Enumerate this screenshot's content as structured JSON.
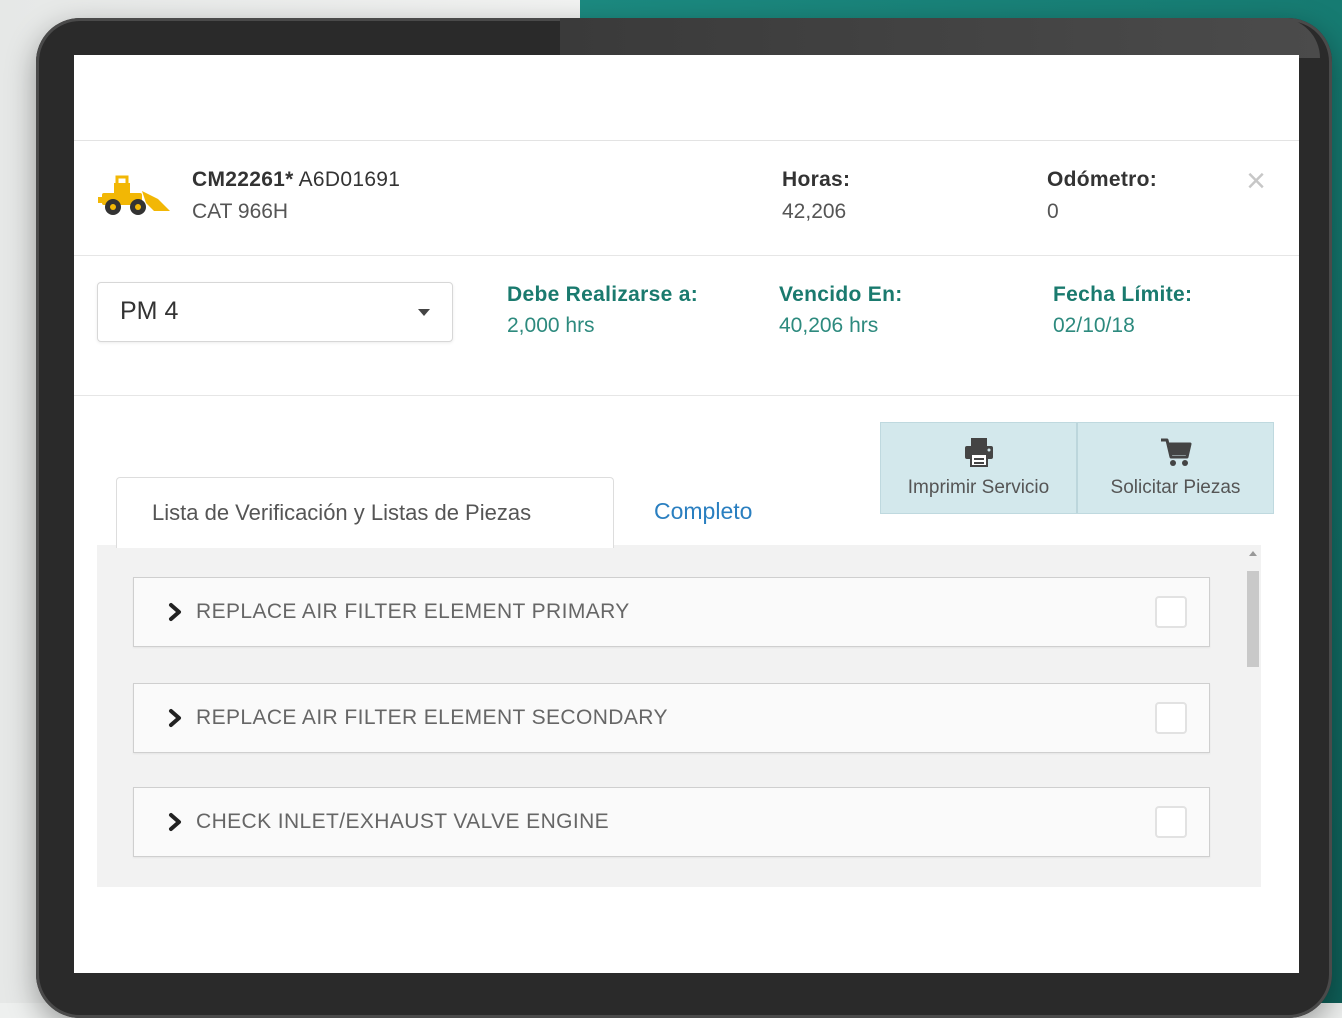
{
  "equipment": {
    "icon": "wheel-loader-icon",
    "id_bold": "CM22261*",
    "id_rest": " A6D01691",
    "model": "CAT 966H",
    "hours_label": "Horas:",
    "hours_value": "42,206",
    "odometer_label": "Odómetro:",
    "odometer_value": "0"
  },
  "service": {
    "selected": "PM 4",
    "due_at_label": "Debe Realizarse a:",
    "due_at_value": "2,000 hrs",
    "overdue_label": "Vencido En:",
    "overdue_value": "40,206 hrs",
    "deadline_label": "Fecha Límite:",
    "deadline_value": "02/10/18"
  },
  "actions": {
    "print_label": "Imprimir Servicio",
    "order_label": "Solicitar Piezas"
  },
  "tabs": {
    "checklist": "Lista de Verificación y Listas de Piezas",
    "complete": "Completo"
  },
  "items": [
    {
      "label": "REPLACE AIR FILTER ELEMENT PRIMARY",
      "checked": false
    },
    {
      "label": "REPLACE AIR FILTER ELEMENT SECONDARY",
      "checked": false
    },
    {
      "label": "CHECK INLET/EXHAUST VALVE ENGINE",
      "checked": false
    }
  ],
  "colors": {
    "accent_green": "#1a7a6e",
    "link_blue": "#2a7fc0",
    "action_bg": "#d3e8ec",
    "loader_yellow": "#f2b705"
  }
}
